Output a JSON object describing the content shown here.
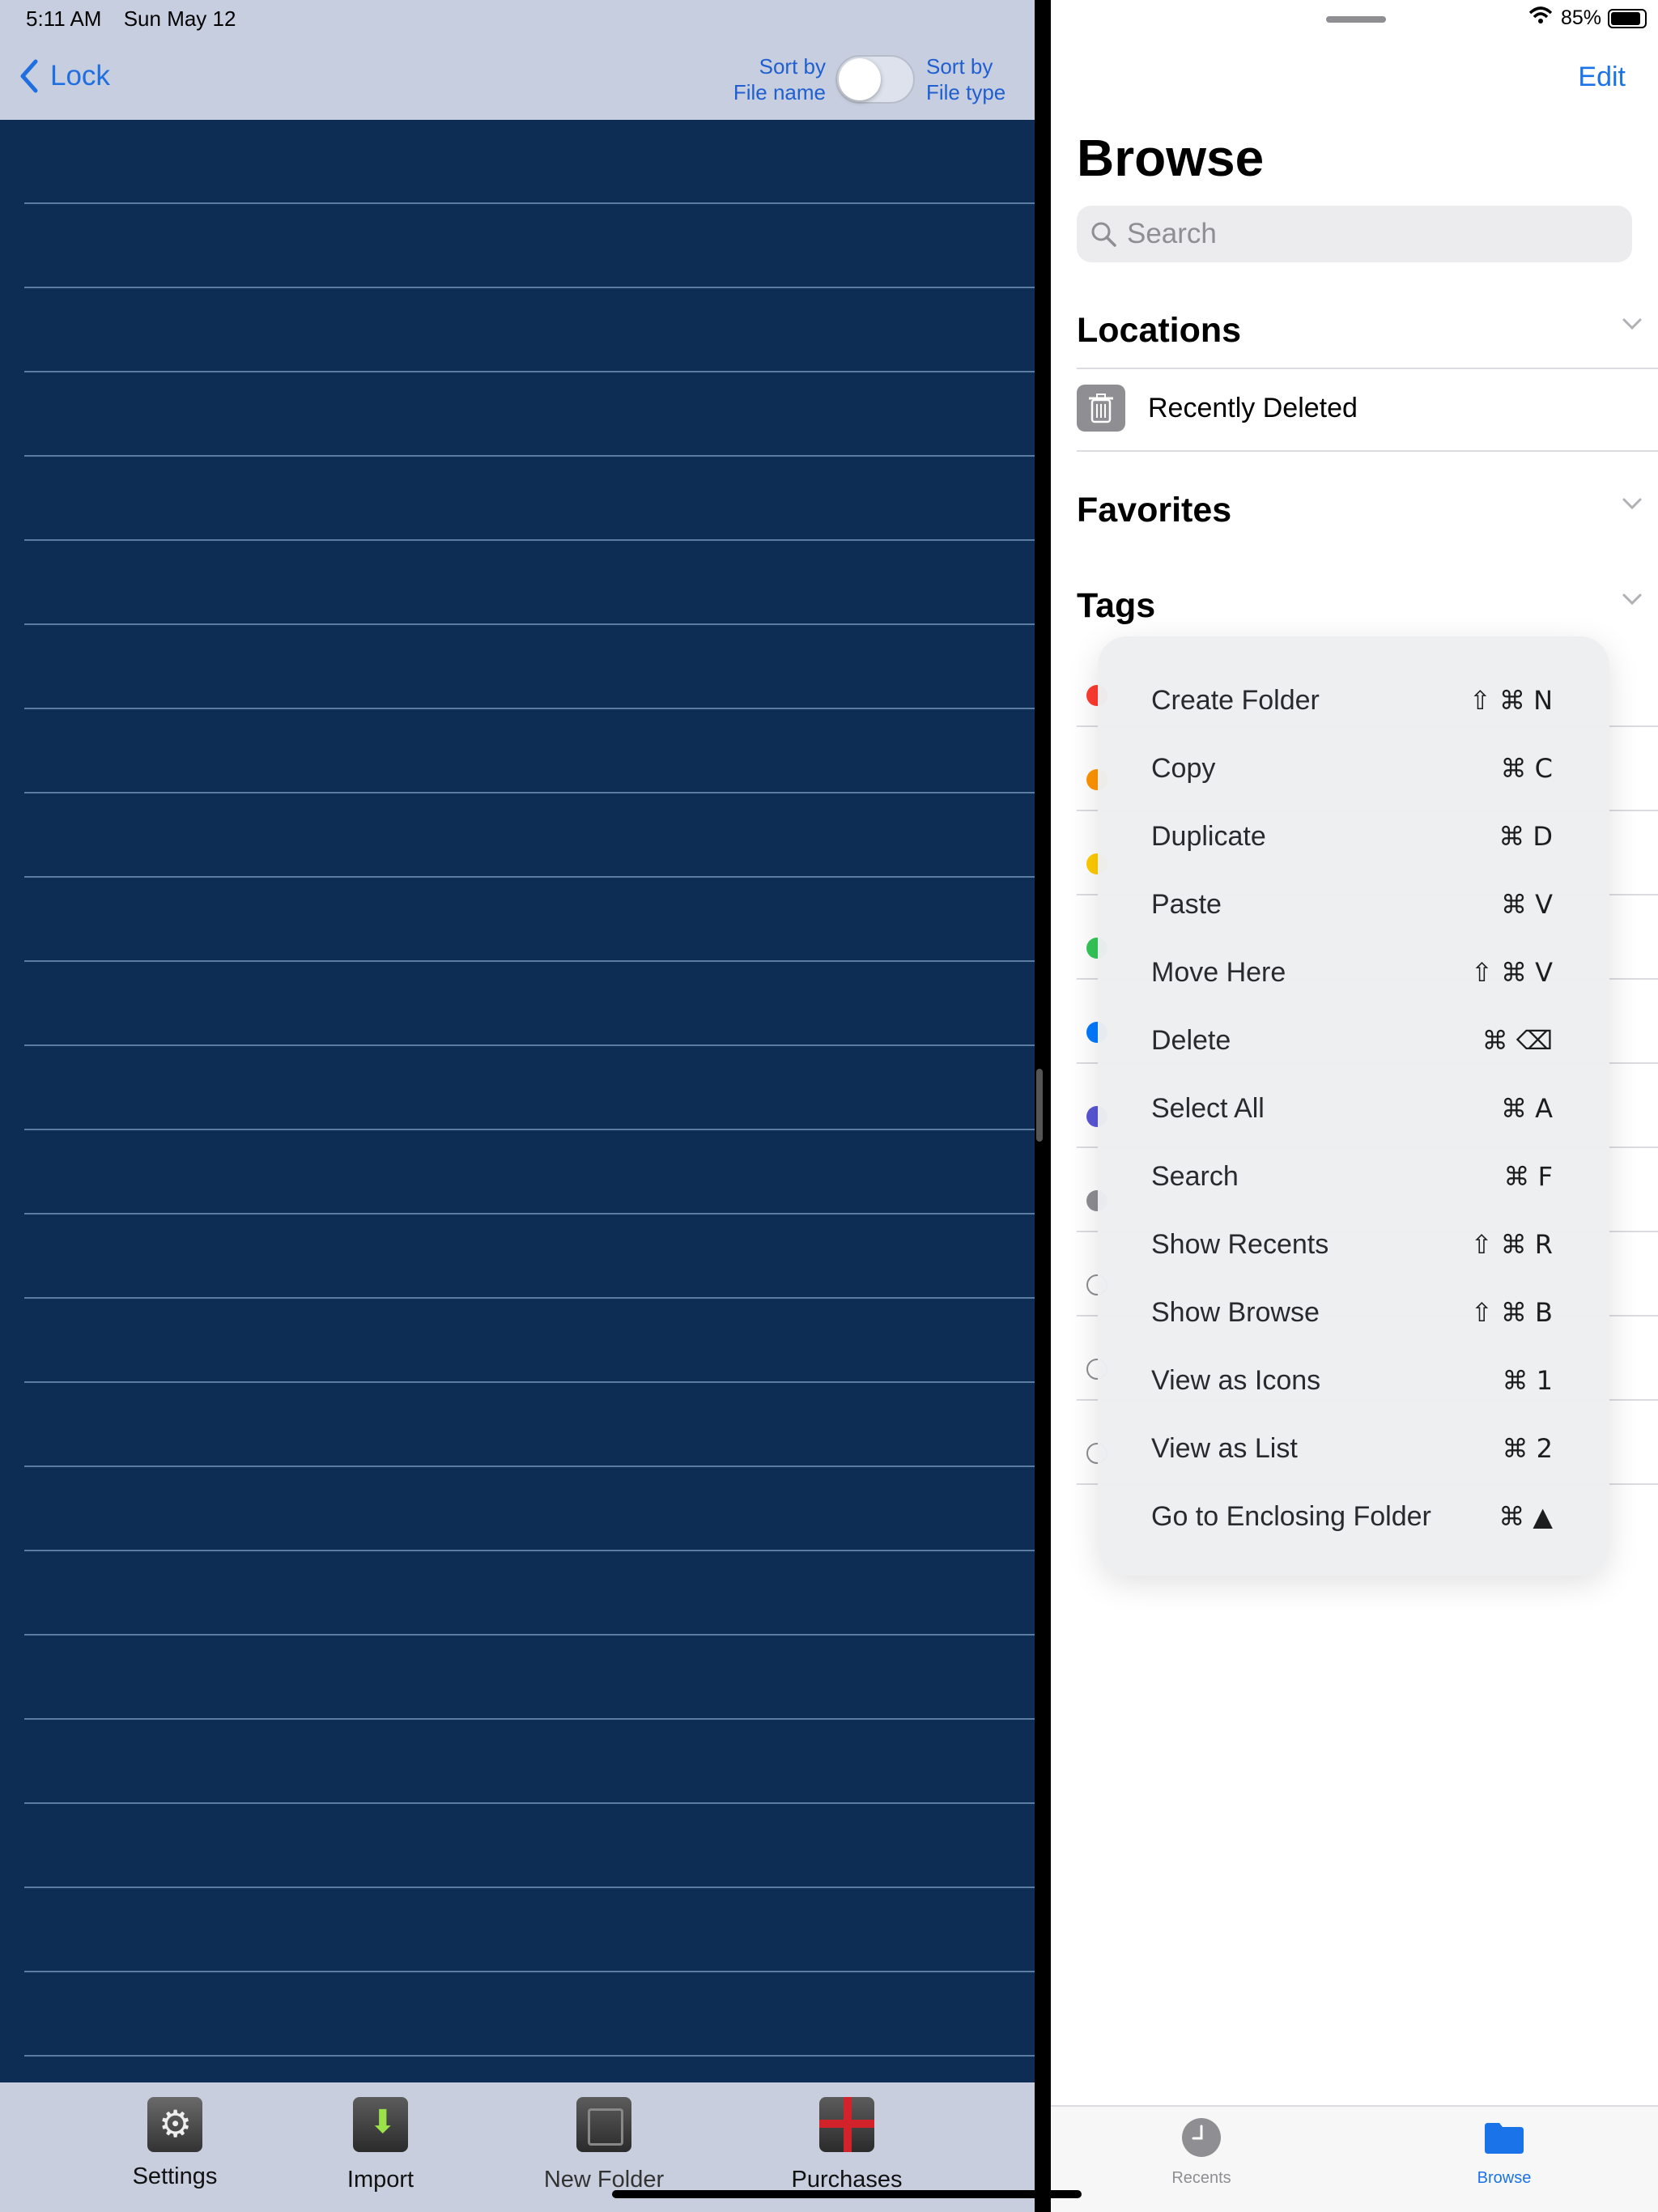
{
  "status": {
    "time": "5:11 AM",
    "date": "Sun May 12",
    "battery": "85%"
  },
  "left_app": {
    "back_label": "Lock",
    "sort_left_line1": "Sort by",
    "sort_left_line2": "File name",
    "sort_right_line1": "Sort by",
    "sort_right_line2": "File type",
    "toggle_on": false,
    "toolbar": [
      {
        "label": "Settings",
        "icon": "settings-icon"
      },
      {
        "label": "Import",
        "icon": "import-icon"
      },
      {
        "label": "New Folder",
        "icon": "new-folder-icon"
      },
      {
        "label": "Purchases",
        "icon": "purchases-icon"
      }
    ]
  },
  "right_app": {
    "edit_label": "Edit",
    "title": "Browse",
    "search_placeholder": "Search",
    "sections": {
      "locations": "Locations",
      "favorites": "Favorites",
      "tags": "Tags"
    },
    "locations": [
      {
        "label": "Recently Deleted",
        "icon": "trash-icon"
      }
    ],
    "tag_colors": [
      "#ff3b30",
      "#ff9500",
      "#ffcc00",
      "#34c759",
      "#007aff",
      "#5856d6",
      "#8e8e93",
      "outline",
      "outline",
      "outline"
    ],
    "context_menu": [
      {
        "label": "Create Folder",
        "shortcut": "⇧ ⌘ N"
      },
      {
        "label": "Copy",
        "shortcut": "⌘ C"
      },
      {
        "label": "Duplicate",
        "shortcut": "⌘ D"
      },
      {
        "label": "Paste",
        "shortcut": "⌘ V"
      },
      {
        "label": "Move Here",
        "shortcut": "⇧ ⌘ V"
      },
      {
        "label": "Delete",
        "shortcut": "⌘ ⌫"
      },
      {
        "label": "Select All",
        "shortcut": "⌘ A"
      },
      {
        "label": "Search",
        "shortcut": "⌘ F"
      },
      {
        "label": "Show Recents",
        "shortcut": "⇧ ⌘ R"
      },
      {
        "label": "Show Browse",
        "shortcut": "⇧ ⌘ B"
      },
      {
        "label": "View as Icons",
        "shortcut": "⌘ 1"
      },
      {
        "label": "View as List",
        "shortcut": "⌘ 2"
      },
      {
        "label": "Go to Enclosing Folder",
        "shortcut": "⌘ ▲"
      }
    ],
    "tabs": [
      {
        "label": "Recents",
        "icon": "clock-icon",
        "active": false
      },
      {
        "label": "Browse",
        "icon": "folder-icon",
        "active": true
      }
    ],
    "accent": "#1a73e8"
  }
}
